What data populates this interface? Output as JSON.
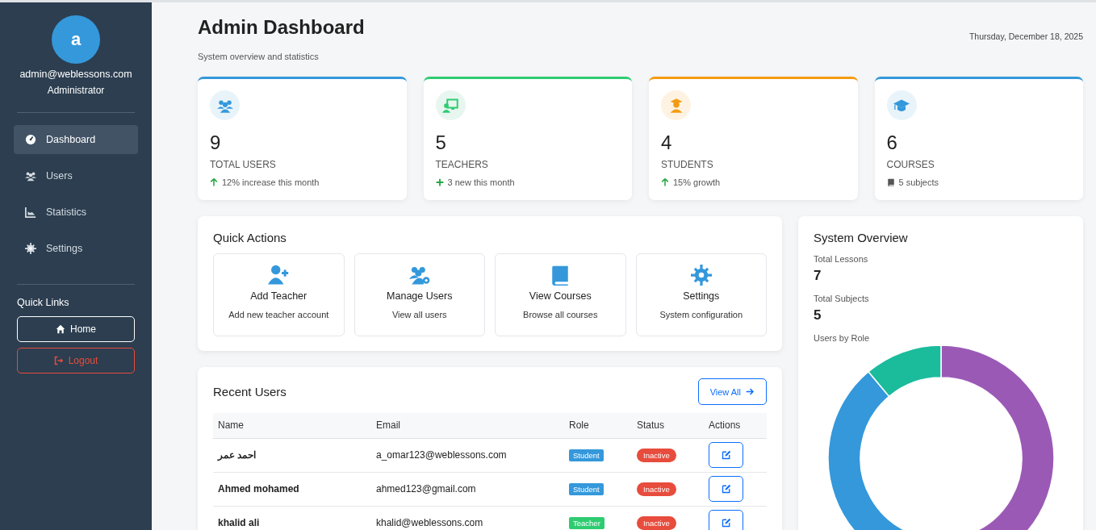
{
  "sidebar": {
    "avatar_letter": "a",
    "email": "admin@weblessons.com",
    "role": "Administrator",
    "nav_items": [
      {
        "label": "Dashboard",
        "selected": true
      },
      {
        "label": "Users",
        "selected": false
      },
      {
        "label": "Statistics",
        "selected": false
      },
      {
        "label": "Settings",
        "selected": false
      }
    ],
    "quick_links_title": "Quick Links",
    "quick_links": [
      {
        "label": "Home",
        "kind": "home"
      },
      {
        "label": "Logout",
        "kind": "logout"
      }
    ]
  },
  "header": {
    "title": "Admin Dashboard",
    "subtitle": "System overview and statistics",
    "date": "Thursday, December 18, 2025"
  },
  "stats": [
    {
      "value": "9",
      "label": "TOTAL USERS",
      "note": "12% increase this month",
      "color": "#3498db"
    },
    {
      "value": "5",
      "label": "TEACHERS",
      "note": "3 new this month",
      "color": "#2ecc71"
    },
    {
      "value": "4",
      "label": "STUDENTS",
      "note": "15% growth",
      "color": "#f39c12"
    },
    {
      "value": "6",
      "label": "COURSES",
      "note": "5 subjects",
      "color": "#3498db"
    }
  ],
  "quick_actions": {
    "title": "Quick Actions",
    "items": [
      {
        "title": "Add Teacher",
        "desc": "Add new teacher account"
      },
      {
        "title": "Manage Users",
        "desc": "View all users"
      },
      {
        "title": "View Courses",
        "desc": "Browse all courses"
      },
      {
        "title": "Settings",
        "desc": "System configuration"
      }
    ]
  },
  "recent_users": {
    "title": "Recent Users",
    "button": "View All",
    "columns": [
      "Name",
      "Email",
      "Role",
      "Status",
      "Actions"
    ],
    "rows": [
      {
        "name": "احمد عمر",
        "email": "a_omar123@weblessons.com",
        "role": "Student",
        "kind": "student",
        "status": "Inactive"
      },
      {
        "name": "Ahmed mohamed",
        "email": "ahmed123@gmail.com",
        "role": "Student",
        "kind": "student",
        "status": "Inactive"
      },
      {
        "name": "khalid ali",
        "email": "khalid@weblessons.com",
        "role": "Teacher",
        "kind": "teacher",
        "status": "Inactive"
      }
    ]
  },
  "overview": {
    "title": "System Overview",
    "stats": [
      {
        "label": "Total Lessons",
        "value": "7"
      },
      {
        "label": "Total Subjects",
        "value": "5"
      }
    ],
    "chart_title": "Users by Role"
  }
}
